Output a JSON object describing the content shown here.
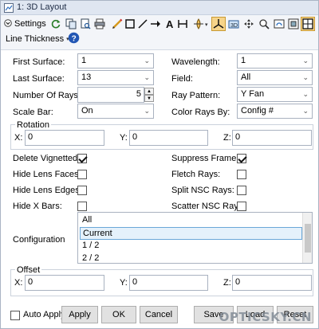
{
  "window": {
    "title": "1: 3D Layout"
  },
  "toolbar": {
    "settings_label": "Settings",
    "line_thickness_label": "Line Thickness",
    "icons": [
      "refresh-icon",
      "copy-icon",
      "print-preview-icon",
      "print-icon",
      "pencil-icon",
      "rectangle-icon",
      "line-arrow-icon",
      "arrow-icon",
      "text-icon",
      "dimension-icon",
      "lens-icon",
      "axes-icon",
      "3d-view-icon",
      "pan-icon",
      "zoom-icon",
      "rotate-icon",
      "fit-icon",
      "layout-icon",
      "help-icon"
    ]
  },
  "form": {
    "first_surface": {
      "label": "First Surface:",
      "value": "1"
    },
    "last_surface": {
      "label": "Last Surface:",
      "value": "13"
    },
    "number_of_rays": {
      "label": "Number Of Rays:",
      "value": "5"
    },
    "scale_bar": {
      "label": "Scale Bar:",
      "value": "On"
    },
    "wavelength": {
      "label": "Wavelength:",
      "value": "1"
    },
    "field": {
      "label": "Field:",
      "value": "All"
    },
    "ray_pattern": {
      "label": "Ray Pattern:",
      "value": "Y Fan"
    },
    "color_rays_by": {
      "label": "Color Rays By:",
      "value": "Config #"
    },
    "rotation": {
      "label": "Rotation",
      "x_label": "X:",
      "x": "0",
      "y_label": "Y:",
      "y": "0",
      "z_label": "Z:",
      "z": "0"
    },
    "delete_vignetted": {
      "label": "Delete Vignetted:",
      "checked": true
    },
    "hide_lens_faces": {
      "label": "Hide Lens Faces:",
      "checked": false
    },
    "hide_lens_edges": {
      "label": "Hide Lens Edges:",
      "checked": false
    },
    "hide_x_bars": {
      "label": "Hide X Bars:",
      "checked": false
    },
    "suppress_frame": {
      "label": "Suppress Frame:",
      "checked": true
    },
    "fletch_rays": {
      "label": "Fletch Rays:",
      "checked": false
    },
    "split_nsc_rays": {
      "label": "Split NSC Rays:",
      "checked": false
    },
    "scatter_nsc_rays": {
      "label": "Scatter NSC Rays:",
      "checked": false
    },
    "configuration": {
      "label": "Configuration",
      "options": [
        "All",
        "Current",
        "1 / 2",
        "2 / 2"
      ],
      "selected": "Current"
    },
    "offset": {
      "label": "Offset",
      "x_label": "X:",
      "x": "0",
      "y_label": "Y:",
      "y": "0",
      "z_label": "Z:",
      "z": "0"
    }
  },
  "footer": {
    "auto_apply_label": "Auto Apply",
    "auto_apply_checked": false,
    "apply_label": "Apply",
    "ok_label": "OK",
    "cancel_label": "Cancel",
    "save_label": "Save",
    "load_label": "Load",
    "reset_label": "Reset"
  },
  "watermark": "OPTICSKY.CN"
}
